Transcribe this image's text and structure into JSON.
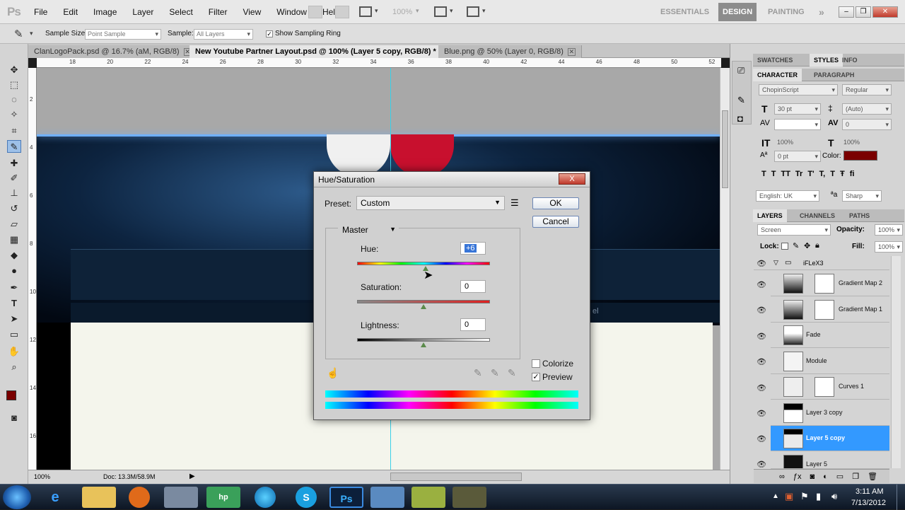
{
  "app": {
    "logo": "Ps"
  },
  "menu": [
    "File",
    "Edit",
    "Image",
    "Layer",
    "Select",
    "Filter",
    "View",
    "Window",
    "Help"
  ],
  "appbar": {
    "zoom": "100%"
  },
  "workspaces": {
    "essentials": "ESSENTIALS",
    "design": "DESIGN",
    "painting": "PAINTING",
    "more": "»"
  },
  "window_controls": {
    "minimize": "–",
    "restore": "❐",
    "close": "✕"
  },
  "options": {
    "sample_size_label": "Sample Size:",
    "sample_size_value": "Point Sample",
    "sample_label": "Sample:",
    "sample_value": "All Layers",
    "sampling_ring_label": "Show Sampling Ring",
    "sampling_ring_checked": "✓"
  },
  "doc_tabs": [
    {
      "label": "ClanLogoPack.psd @ 16.7% (aM, RGB/8)"
    },
    {
      "label": "New Youtube Partner Layout.psd @ 100% (Layer 5 copy, RGB/8) *"
    },
    {
      "label": "Blue.png @ 50% (Layer 0, RGB/8)"
    }
  ],
  "ruler_ticks": [
    "18",
    "20",
    "22",
    "24",
    "26",
    "28",
    "30",
    "32",
    "34",
    "36",
    "38",
    "40",
    "42",
    "44",
    "46",
    "48",
    "50",
    "52"
  ],
  "ruler_v_ticks": [
    "2",
    "4",
    "6",
    "8",
    "10",
    "12",
    "14",
    "16"
  ],
  "status": {
    "zoom": "100%",
    "doc": "Doc: 13.3M/58.9M"
  },
  "canvas": {
    "search_hint": "el"
  },
  "panels": {
    "top_tabs": [
      "SWATCHES",
      "STYLES",
      "INFO"
    ],
    "char_tabs": [
      "CHARACTER",
      "PARAGRAPH"
    ],
    "font_family": "ChopinScript",
    "font_style": "Regular",
    "font_size": "30 pt",
    "leading": "(Auto)",
    "kerning_value": "",
    "tracking": "0",
    "vscale": "100%",
    "hscale": "100%",
    "baseline": "0 pt",
    "color_label": "Color:",
    "text_color": "#7a0000",
    "typo_buttons": [
      "T",
      "T",
      "TT",
      "Tr",
      "T'",
      "T,",
      "T",
      "Ŧ",
      "ﬁ"
    ],
    "language": "English: UK",
    "aa_label": "ªa",
    "antialias": "Sharp",
    "layer_tabs": [
      "LAYERS",
      "CHANNELS",
      "PATHS"
    ],
    "blend_mode": "Screen",
    "opacity_label": "Opacity:",
    "opacity": "100%",
    "lock_label": "Lock:",
    "fill_label": "Fill:",
    "fill": "100%",
    "group_name": "iFLeX3",
    "layers": [
      {
        "name": "Gradient Map 2"
      },
      {
        "name": "Gradient Map 1"
      },
      {
        "name": "Fade"
      },
      {
        "name": "Module"
      },
      {
        "name": "Curves 1"
      },
      {
        "name": "Layer 3 copy"
      },
      {
        "name": "Layer 5 copy"
      },
      {
        "name": "Layer 5"
      }
    ]
  },
  "dialog": {
    "title": "Hue/Saturation",
    "close": "X",
    "preset_label": "Preset:",
    "preset_value": "Custom",
    "ok": "OK",
    "cancel": "Cancel",
    "channel": "Master",
    "hue_label": "Hue:",
    "hue_value": "+6",
    "hue_level": 6,
    "saturation_label": "Saturation:",
    "saturation_value": "0",
    "lightness_label": "Lightness:",
    "lightness_value": "0",
    "colorize_label": "Colorize",
    "preview_label": "Preview",
    "preview_checked": "✓"
  },
  "taskbar": {
    "apps": [
      "",
      "e",
      "",
      "",
      "hp",
      "",
      "S",
      "Ps",
      "",
      "",
      ""
    ],
    "time": "3:11 AM",
    "date": "7/13/2012"
  }
}
